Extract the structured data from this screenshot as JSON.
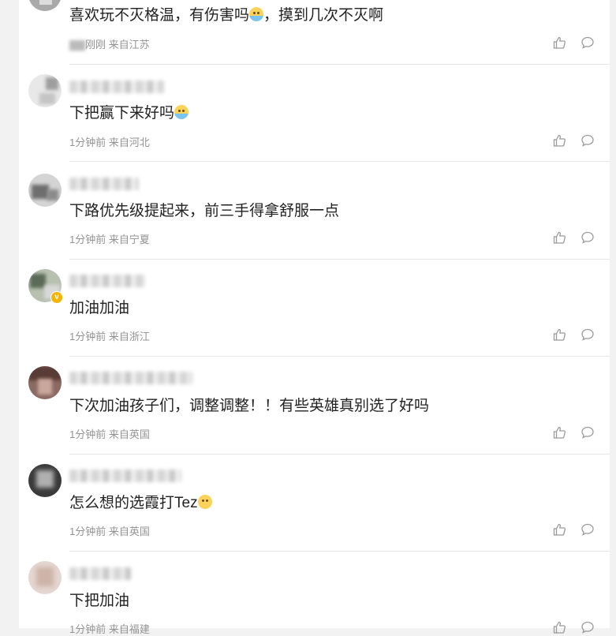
{
  "comments": [
    {
      "text": "喜欢玩不灭格温，有伤害吗",
      "emoji": "cry",
      "text_after": "，摸到几次不灭啊",
      "time": "刚刚",
      "location": "来自江苏",
      "verified": false
    },
    {
      "text": "下把赢下来好吗",
      "emoji": "cry",
      "text_after": "",
      "time": "1分钟前",
      "location": "来自河北",
      "verified": false
    },
    {
      "text": "下路优先级提起来，前三手得拿舒服一点",
      "emoji": "",
      "text_after": "",
      "time": "1分钟前",
      "location": "来自宁夏",
      "verified": false
    },
    {
      "text": "加油加油",
      "emoji": "",
      "text_after": "",
      "time": "1分钟前",
      "location": "来自浙江",
      "verified": true
    },
    {
      "text": "下次加油孩子们，调整调整！！有些英雄真别选了好吗",
      "emoji": "",
      "text_after": "",
      "time": "1分钟前",
      "location": "来自英国",
      "verified": false
    },
    {
      "text": "怎么想的选霞打Tez",
      "emoji": "smile",
      "text_after": "",
      "time": "1分钟前",
      "location": "来自英国",
      "verified": false
    },
    {
      "text": "下把加油",
      "emoji": "",
      "text_after": "",
      "time": "1分钟前",
      "location": "来自福建",
      "verified": false
    }
  ],
  "icons": {
    "like": "thumbs-up-icon",
    "reply": "comment-bubble-icon"
  },
  "colors": {
    "text": "#222222",
    "meta": "#939393",
    "divider": "#e6e6e6",
    "badge": "#f5b400"
  }
}
